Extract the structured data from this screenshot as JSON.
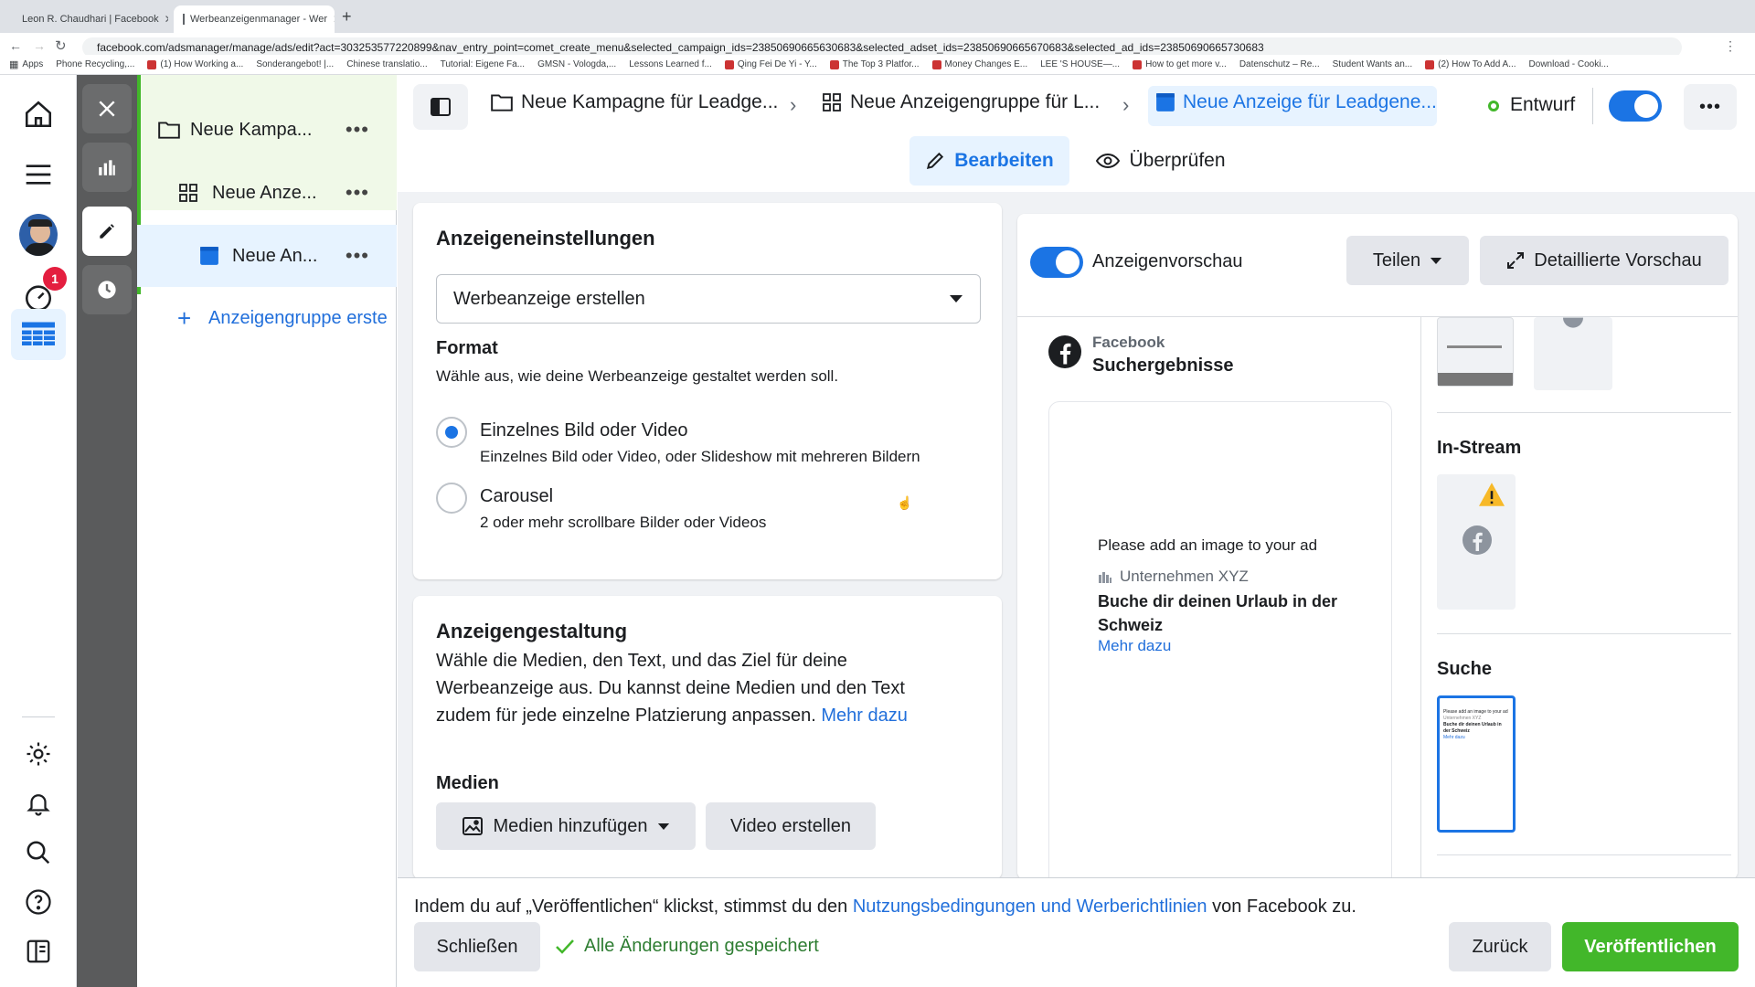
{
  "browser": {
    "tabs": [
      {
        "title": "Leon R. Chaudhari | Facebook"
      },
      {
        "title": "Werbeanzeigenmanager - Wer"
      }
    ],
    "url": "facebook.com/adsmanager/manage/ads/edit?act=303253577220899&nav_entry_point=comet_create_menu&selected_campaign_ids=23850690665630683&selected_adset_ids=23850690665670683&selected_ad_ids=23850690665730683",
    "bookmarks": [
      "Apps",
      "Phone Recycling,...",
      "(1) How Working a...",
      "Sonderangebot! |...",
      "Chinese translatio...",
      "Tutorial: Eigene Fa...",
      "GMSN - Vologda,...",
      "Lessons Learned f...",
      "Qing Fei De Yi - Y...",
      "The Top 3 Platfor...",
      "Money Changes E...",
      "LEE 'S HOUSE—...",
      "How to get more v...",
      "Datenschutz – Re...",
      "Student Wants an...",
      "(2) How To Add A...",
      "Download - Cooki..."
    ]
  },
  "leftnav": {
    "notification_count": "1"
  },
  "tree": {
    "campaign": "Neue Kampa...",
    "adset": "Neue Anze...",
    "ad": "Neue An...",
    "add_adset": "Anzeigengruppe erste"
  },
  "breadcrumb": {
    "campaign": "Neue Kampagne für Leadge...",
    "adset": "Neue Anzeigengruppe für L...",
    "ad": "Neue Anzeige für Leadgene..."
  },
  "status": {
    "label": "Entwurf"
  },
  "modetabs": {
    "edit": "Bearbeiten",
    "review": "Überprüfen"
  },
  "settings": {
    "title": "Anzeigeneinstellungen",
    "dropdown_value": "Werbeanzeige erstellen",
    "format_title": "Format",
    "format_desc": "Wähle aus, wie deine Werbeanzeige gestaltet werden soll.",
    "option1_title": "Einzelnes Bild oder Video",
    "option1_desc": "Einzelnes Bild oder Video, oder Slideshow mit mehreren Bildern",
    "option2_title": "Carousel",
    "option2_desc": "2 oder mehr scrollbare Bilder oder Videos"
  },
  "creative": {
    "title": "Anzeigengestaltung",
    "desc": "Wähle die Medien, den Text, und das Ziel für deine Werbeanzeige aus. Du kannst deine Medien und den Text zudem für jede einzelne Platzierung anpassen.",
    "more": "Mehr dazu",
    "media_title": "Medien",
    "add_media": "Medien hinzufügen",
    "create_video": "Video erstellen"
  },
  "preview": {
    "toggle_label": "Anzeigenvorschau",
    "share": "Teilen",
    "detailed": "Detaillierte Vorschau",
    "platform": "Facebook",
    "placement": "Suchergebnisse",
    "no_image": "Please add an image to your ad",
    "company": "Unternehmen XYZ",
    "headline": "Buche dir deinen Urlaub in der Schweiz",
    "cta": "Mehr dazu",
    "section_instream": "In-Stream",
    "section_search": "Suche",
    "mini_text1": "Please add an image to your ad",
    "mini_text2": "Unternehmen XYZ",
    "mini_text3": "Buche dir deinen Urlaub in der Schweiz",
    "mini_text4": "Mehr dazu"
  },
  "footer": {
    "notice_pre": "Indem du auf „Veröffentlichen“ klickst, stimmst du den ",
    "notice_link": "Nutzungsbedingungen und Werberichtlinien",
    "notice_post": " von Facebook zu.",
    "close": "Schließen",
    "saved": "Alle Änderungen gespeichert",
    "back": "Zurück",
    "publish": "Veröffentlichen"
  },
  "colors": {
    "accent": "#1b74e4",
    "publish": "#42b72a",
    "draft_dot": "#42b72a"
  }
}
